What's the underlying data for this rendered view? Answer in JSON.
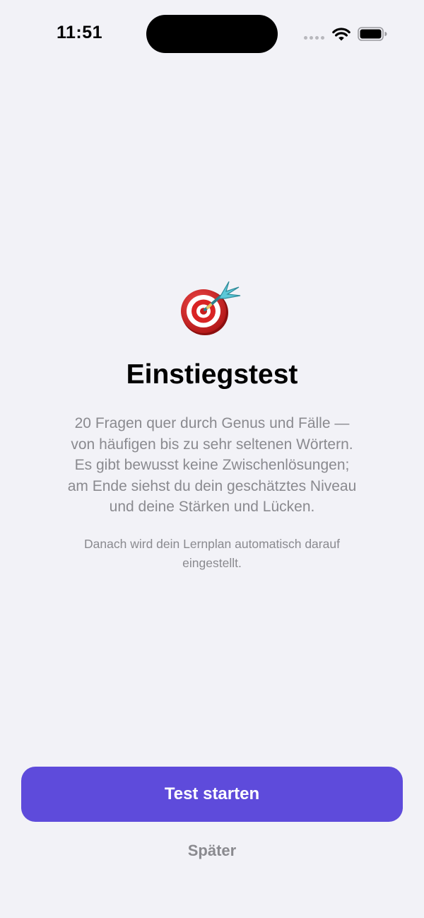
{
  "status_bar": {
    "time": "11:51",
    "icons": [
      "signal-dots-icon",
      "wifi-icon",
      "battery-icon"
    ]
  },
  "hero": {
    "icon": "dart-target-icon"
  },
  "title": "Einstiegstest",
  "description": "20 Fragen quer durch Genus und Fälle —\nvon häufigen bis zu sehr seltenen Wörtern.\nEs gibt bewusst keine Zwischenlösungen;\nam Ende siehst du dein geschätztes Niveau\nund deine Stärken und Lücken.",
  "note": "Danach wird dein Lernplan automatisch darauf\neingestellt.",
  "actions": {
    "start_label": "Test starten",
    "later_label": "Später"
  },
  "colors": {
    "background": "#f2f2f7",
    "accent": "#5e4bdb",
    "secondary_text": "#8a8a8f"
  }
}
